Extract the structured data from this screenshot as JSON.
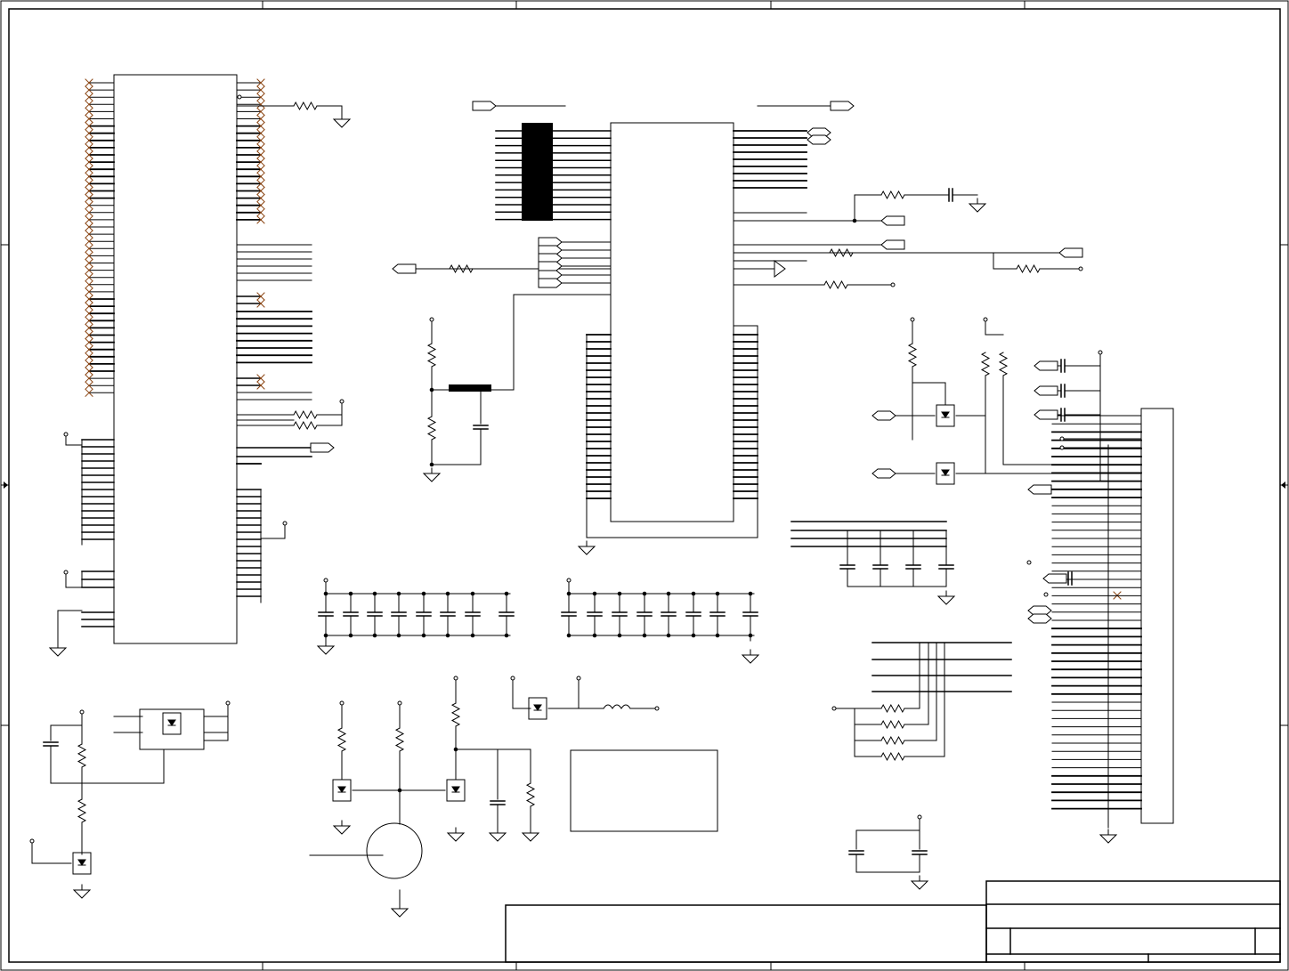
{
  "diagram": {
    "kind": "electrical schematic sheet",
    "line_color": "#000000",
    "no_connect_color": "#8B4513",
    "background": "#ffffff",
    "title_block": {
      "title": "",
      "sheet": "",
      "revision": ""
    }
  }
}
